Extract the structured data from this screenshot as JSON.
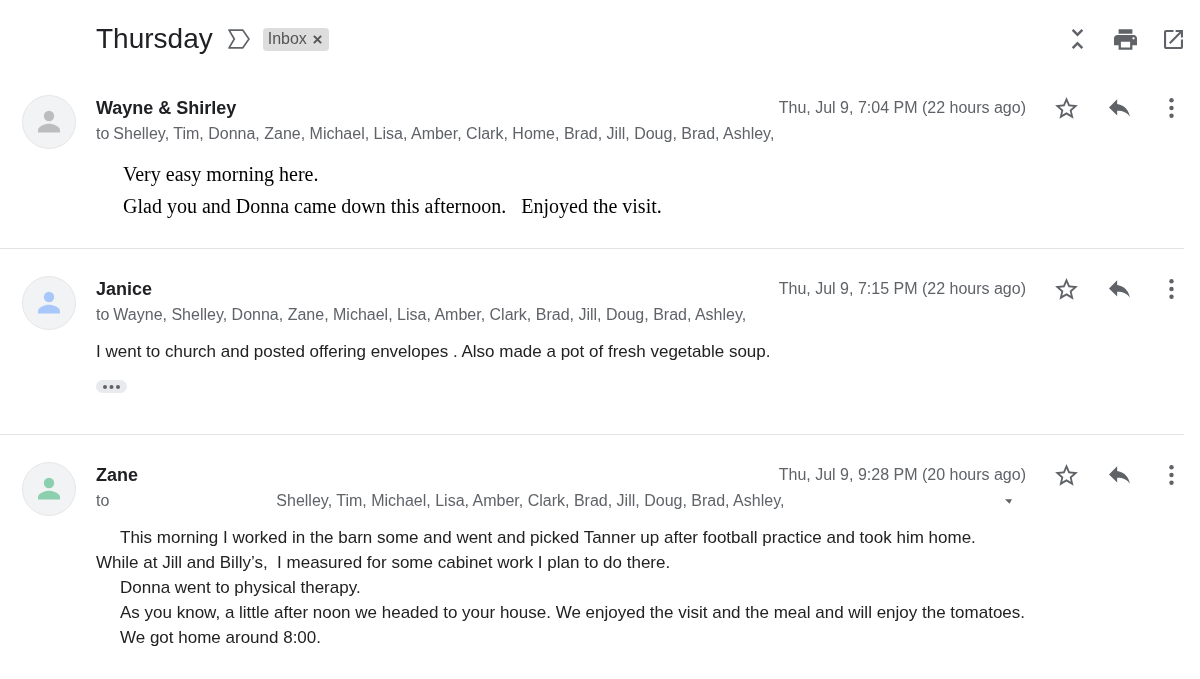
{
  "header": {
    "title": "Thursday",
    "important": false,
    "labels": [
      {
        "name": "Inbox"
      }
    ]
  },
  "messages": [
    {
      "sender": "Wayne & Shirley",
      "avatar": {
        "color": "#bdbdbd"
      },
      "date": "Thu, Jul 9, 7:04 PM (22 hours ago)",
      "starred": false,
      "recipients": {
        "prefix": "to",
        "names": "Shelley, Tim, Donna, Zane, Michael, Lisa, Amber, Clark, Home, Brad, Jill, Doug, Brad, Ashley,"
      },
      "kind": "rich",
      "body": [
        {
          "text": "Very easy morning here.",
          "indented": true
        },
        {
          "text": "Glad you and Donna came down this afternoon.   Enjoyed the visit.",
          "indented": true
        }
      ]
    },
    {
      "sender": "Janice",
      "avatar": {
        "color": "#a8c7fa"
      },
      "date": "Thu, Jul 9, 7:15 PM (22 hours ago)",
      "starred": false,
      "recipients": {
        "prefix": "to",
        "names": "Wayne, Shelley, Donna, Zane, Michael, Lisa, Amber, Clark, Brad, Jill, Doug, Brad, Ashley,"
      },
      "kind": "plain",
      "body": [
        {
          "text": "I went to church and posted offering envelopes . Also made a pot of fresh vegetable soup.",
          "indented": false
        }
      ],
      "trimmed_content": true
    },
    {
      "sender": "Zane",
      "avatar": {
        "color": "#8ccfae"
      },
      "date": "Thu, Jul 9, 9:28 PM (20 hours ago)",
      "starred": false,
      "recipients": {
        "prefix": "to",
        "names": "Shelley, Tim, Michael, Lisa, Amber, Clark, Brad, Jill, Doug, Brad, Ashley,",
        "redacted": true,
        "details_caret": true
      },
      "kind": "plain",
      "body": [
        {
          "text": "This morning I worked in the barn some and went and picked Tanner up after football practice and took him home.",
          "indented": true
        },
        {
          "text": "While at Jill and Billy’s,  I measured for some cabinet work I plan to do there.",
          "indented": false
        },
        {
          "text": "Donna went to physical therapy.",
          "indented": true
        },
        {
          "text": "As you know, a little after noon we headed to your house. We enjoyed the visit and the meal and will enjoy the tomatoes.",
          "indented": true
        },
        {
          "text": "We got home around 8:00.",
          "indented": true
        }
      ]
    }
  ]
}
